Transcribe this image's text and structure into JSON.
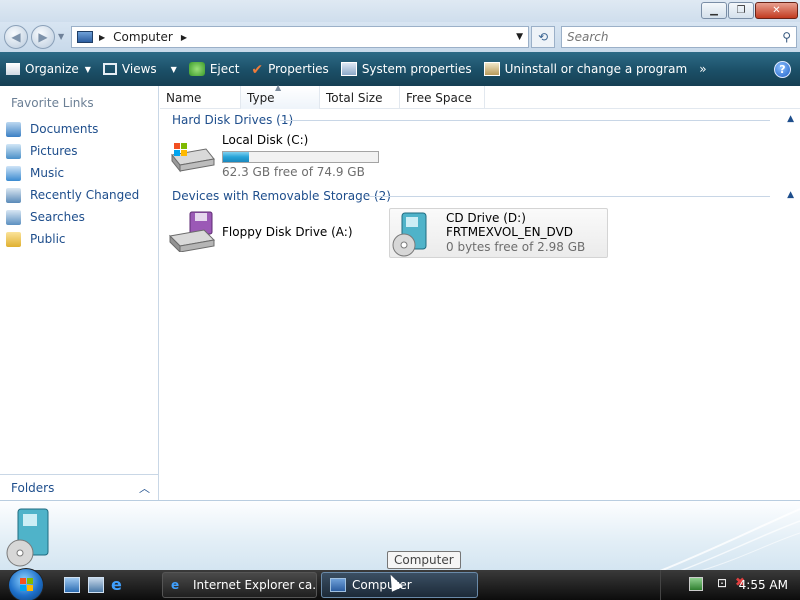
{
  "window": {
    "title": "Computer",
    "controls": [
      "minimize",
      "restore",
      "close"
    ]
  },
  "address": {
    "path": "Computer",
    "search_placeholder": "Search"
  },
  "toolbar": {
    "organize": "Organize",
    "views": "Views",
    "eject": "Eject",
    "properties": "Properties",
    "system_properties": "System properties",
    "uninstall": "Uninstall or change a program",
    "more": "»",
    "help": "?"
  },
  "nav": {
    "favorite_links_title": "Favorite Links",
    "links": [
      {
        "label": "Documents",
        "icon": "documents-icon",
        "color": "#3b7fc4"
      },
      {
        "label": "Pictures",
        "icon": "pictures-icon",
        "color": "#4a90c8"
      },
      {
        "label": "Music",
        "icon": "music-icon",
        "color": "#3a8ad0"
      },
      {
        "label": "Recently Changed",
        "icon": "recently-changed-icon",
        "color": "#5a8ab8"
      },
      {
        "label": "Searches",
        "icon": "searches-icon",
        "color": "#5c90c0"
      },
      {
        "label": "Public",
        "icon": "public-folder-icon",
        "color": "#e0b030"
      }
    ],
    "folders_label": "Folders"
  },
  "columns": [
    "Name",
    "Type",
    "Total Size",
    "Free Space"
  ],
  "groups": {
    "hard_disk": {
      "title": "Hard Disk Drives (1)",
      "drives": [
        {
          "name": "Local Disk (C:)",
          "free_text": "62.3 GB free of 74.9 GB",
          "used_fraction": 0.17
        }
      ]
    },
    "removable": {
      "title": "Devices with Removable Storage (2)",
      "drives": [
        {
          "name": "Floppy Disk Drive (A:)"
        },
        {
          "name": "CD Drive (D:)",
          "label": "FRTMEXVOL_EN_DVD",
          "free_text": "0 bytes free of 2.98 GB"
        }
      ]
    }
  },
  "taskbar": {
    "tasks": [
      {
        "label": "Internet Explorer ca..."
      },
      {
        "label": "Computer"
      }
    ],
    "clock": "4:55 AM",
    "tooltip": "Computer"
  },
  "colors": {
    "accent": "#1e4e8c",
    "toolbar": "#1b4f67",
    "progress": "#27a4d8"
  }
}
